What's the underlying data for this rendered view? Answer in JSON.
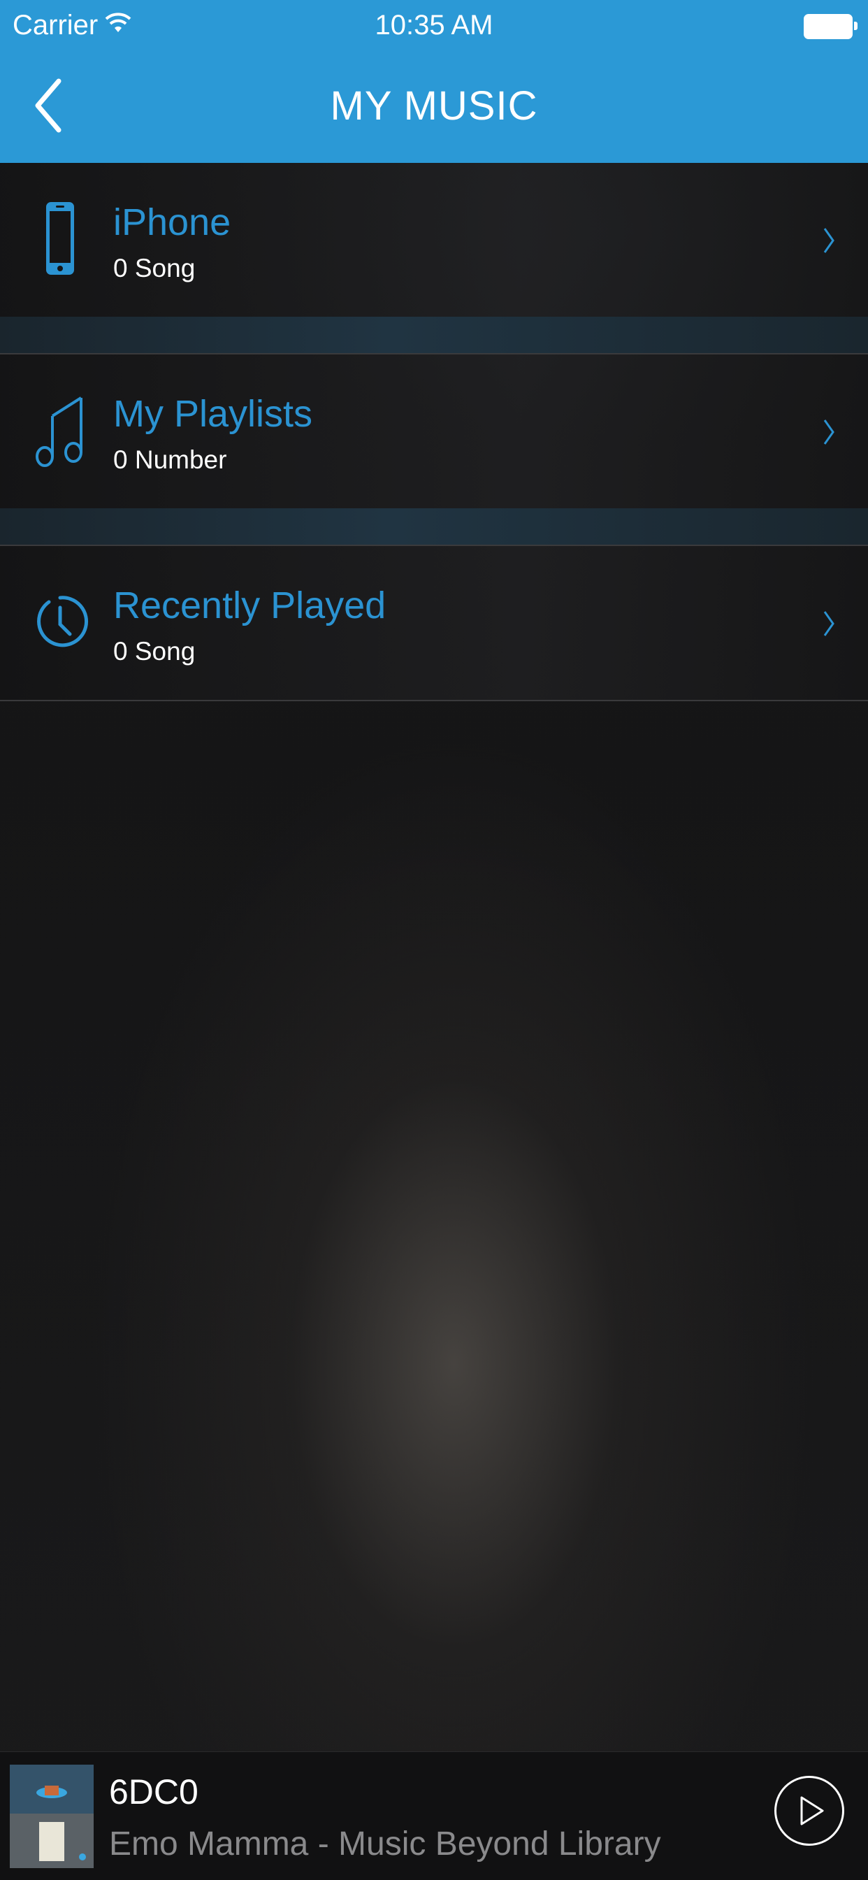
{
  "status_bar": {
    "carrier": "Carrier",
    "time": "10:35 AM"
  },
  "nav": {
    "title": "MY MUSIC",
    "back_icon": "chevron-left-icon"
  },
  "accent_color": "#2b99d6",
  "items": [
    {
      "title": "iPhone",
      "subtitle": "0 Song",
      "icon": "phone-icon"
    },
    {
      "title": "My Playlists",
      "subtitle": "0 Number",
      "icon": "music-note-icon"
    },
    {
      "title": "Recently Played",
      "subtitle": "0 Song",
      "icon": "clock-icon"
    }
  ],
  "player": {
    "track_title": "6DC0",
    "track_subtitle": "Emo Mamma - Music Beyond Library",
    "play_icon": "play-icon"
  }
}
